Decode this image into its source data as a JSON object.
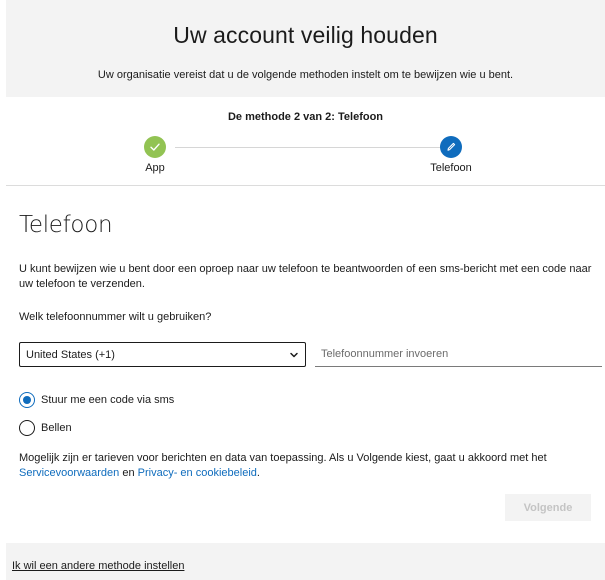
{
  "header": {
    "title": "Uw account veilig houden",
    "subtitle": "Uw organisatie vereist dat u de volgende methoden instelt om te bewijzen wie u bent."
  },
  "progress": {
    "caption": "De methode 2 van 2: Telefoon",
    "steps": [
      {
        "label": "App",
        "state": "completed",
        "icon": "checkmark-icon"
      },
      {
        "label": "Telefoon",
        "state": "active",
        "icon": "pencil-icon"
      }
    ]
  },
  "section": {
    "title": "Telefoon",
    "description": "U kunt bewijzen wie u bent door een oproep naar uw telefoon te beantwoorden of een sms-bericht met een code naar uw telefoon te verzenden.",
    "question": "Welk telefoonnummer wilt u gebruiken?"
  },
  "form": {
    "country_value": "United States (+1)",
    "phone_placeholder": "Telefoonnummer invoeren",
    "options": [
      {
        "label": "Stuur me een code via sms",
        "selected": true
      },
      {
        "label": "Bellen",
        "selected": false
      }
    ]
  },
  "note": {
    "text": "Mogelijk zijn er tarieven voor berichten en data van toepassing. Als u Volgende kiest, gaat u akkoord met het",
    "terms_link": "Servicevoorwaarden",
    "conjunction": "en",
    "privacy_link": "Privacy- en cookiebeleid",
    "end": "."
  },
  "actions": {
    "next_label": "Volgende"
  },
  "footer": {
    "other_method_link": "Ik wil een andere methode instellen"
  },
  "colors": {
    "accent": "#0f6cbd",
    "success": "#92c353",
    "panel_bg": "#f3f3f3"
  }
}
